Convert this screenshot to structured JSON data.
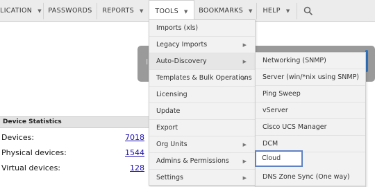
{
  "nav": {
    "items": [
      {
        "label": "LICATION",
        "caret": "▼"
      },
      {
        "label": "PASSWORDS",
        "caret": ""
      },
      {
        "label": "REPORTS",
        "caret": "▼"
      },
      {
        "label": "TOOLS",
        "caret": "▼"
      },
      {
        "label": "BOOKMARKS",
        "caret": "▼"
      },
      {
        "label": "HELP",
        "caret": "▼"
      }
    ],
    "search_icon": "search-icon"
  },
  "tools_menu": {
    "items": [
      {
        "label": "Imports (xls)",
        "arrow": ""
      },
      {
        "label": "Legacy Imports",
        "arrow": "▶"
      },
      {
        "label": "Auto-Discovery",
        "arrow": "▶"
      },
      {
        "label": "Templates & Bulk Operations",
        "arrow": "▶"
      },
      {
        "label": "Licensing",
        "arrow": ""
      },
      {
        "label": "Update",
        "arrow": ""
      },
      {
        "label": "Export",
        "arrow": ""
      },
      {
        "label": "Org Units",
        "arrow": "▶"
      },
      {
        "label": "Admins & Permissions",
        "arrow": "▶"
      },
      {
        "label": "Settings",
        "arrow": "▶"
      }
    ]
  },
  "autodiscovery_menu": {
    "items": [
      {
        "label": "Networking (SNMP)"
      },
      {
        "label": "Server (win/*nix using SNMP)"
      },
      {
        "label": "Ping Sweep"
      },
      {
        "label": "vServer"
      },
      {
        "label": "Cisco UCS Manager"
      },
      {
        "label": "DCM"
      },
      {
        "label": "Cloud"
      },
      {
        "label": "DNS Zone Sync (One way)"
      }
    ]
  },
  "background_panel": {
    "text": "I"
  },
  "device_statistics": {
    "title": "Device Statistics",
    "rows": [
      {
        "label": "Devices:",
        "value": "7018"
      },
      {
        "label": "Physical devices:",
        "value": "1544"
      },
      {
        "label": "Virtual devices:",
        "value": "128"
      }
    ]
  },
  "colors": {
    "highlight_border": "#5e82c4",
    "link": "#1a0dab",
    "accent": "#2f74c0"
  }
}
